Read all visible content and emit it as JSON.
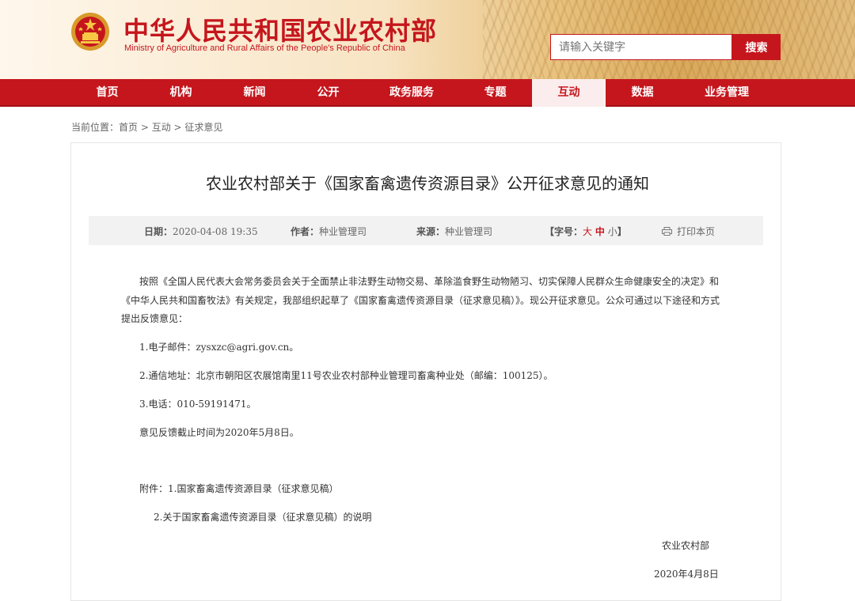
{
  "header": {
    "site_title": "中华人民共和国农业农村部",
    "site_subtitle": "Ministry of Agriculture and Rural Affairs of the People's Republic of China",
    "search_placeholder": "请输入关键字",
    "search_button": "搜索",
    "brand_color": "#c5161d"
  },
  "nav": {
    "items": [
      {
        "label": "首页"
      },
      {
        "label": "机构"
      },
      {
        "label": "新闻"
      },
      {
        "label": "公开"
      },
      {
        "label": "政务服务"
      },
      {
        "label": "专题"
      },
      {
        "label": "互动",
        "active": true
      },
      {
        "label": "数据"
      },
      {
        "label": "业务管理"
      }
    ]
  },
  "breadcrumb": {
    "prefix": "当前位置：",
    "items": [
      "首页",
      "互动",
      "征求意见"
    ],
    "separator": " > "
  },
  "article": {
    "title": "农业农村部关于《国家畜禽遗传资源目录》公开征求意见的通知",
    "meta": {
      "date_label": "日期：",
      "date": "2020-04-08 19:35",
      "author_label": "作者：",
      "author": "种业管理司",
      "source_label": "来源：",
      "source": "种业管理司",
      "fontsize_prefix": "【字号：",
      "fontsize_large": "大",
      "fontsize_medium": "中",
      "fontsize_small": "小",
      "fontsize_suffix": "】",
      "print_label": "打印本页"
    },
    "paragraphs": {
      "intro_line1": "按照《全国人民代表大会常务委员会关于全面禁止非法野生动物交易、革除滥食野生动物陋习、切实保障人民群众生命健康安全的决定》和",
      "intro_line2": "《中华人民共和国畜牧法》有关规定，我部组织起草了《国家畜禽遗传资源目录（征求意见稿）》。现公开征求意见。公众可通过以下途径和方式",
      "intro_line3": "提出反馈意见：",
      "email": "1.电子邮件：zysxzc@agri.gov.cn。",
      "address": "2.通信地址：北京市朝阳区农展馆南里11号农业农村部种业管理司畜禽种业处（邮编：100125）。",
      "phone": "3.电话：010-59191471。",
      "deadline": "意见反馈截止时间为2020年5月8日。",
      "attach1": "附件：1.国家畜禽遗传资源目录（征求意见稿）",
      "attach2": "2.关于国家畜禽遗传资源目录（征求意见稿）的说明"
    },
    "signature": "农业农村部",
    "sign_date": "2020年4月8日"
  }
}
